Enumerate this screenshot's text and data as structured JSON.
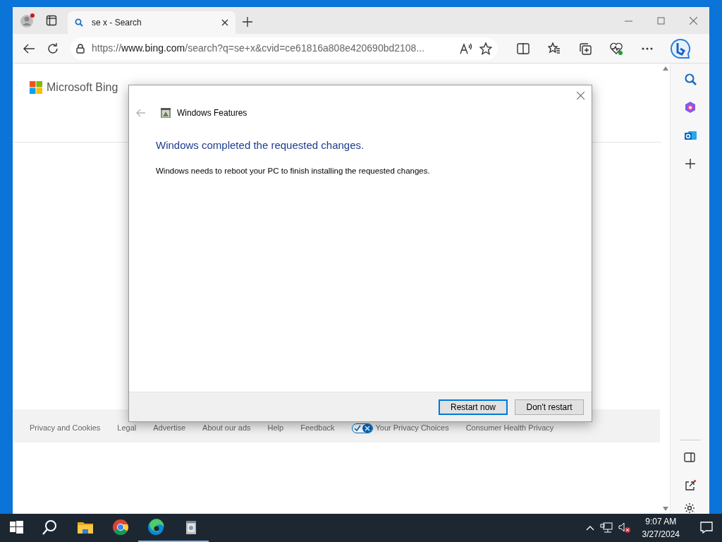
{
  "browser": {
    "tab": {
      "title": "se x - Search",
      "selected": true
    },
    "address": {
      "scheme": "https://",
      "host": "www.bing.com",
      "path": "/search?q=se+x&cvid=ce61816a808e420690bd2108..."
    }
  },
  "page": {
    "logo": "Microsoft Bing",
    "footer_links": [
      {
        "label": "Privacy and Cookies"
      },
      {
        "label": "Legal"
      },
      {
        "label": "Advertise"
      },
      {
        "label": "About our ads"
      },
      {
        "label": "Help"
      },
      {
        "label": "Feedback"
      },
      {
        "label": "Your Privacy Choices",
        "kind": "privacy"
      },
      {
        "label": "Consumer Health Privacy"
      }
    ]
  },
  "dialog": {
    "title": "Windows Features",
    "heading": "Windows completed the requested changes.",
    "message": "Windows needs to reboot your PC to finish installing the requested changes.",
    "buttons": [
      {
        "label": "Restart now",
        "selected": true
      },
      {
        "label": "Don't restart",
        "selected": false
      }
    ]
  },
  "taskbar": {
    "apps": [
      {
        "kind": "folder",
        "running": false
      },
      {
        "kind": "chrome",
        "running": false
      },
      {
        "kind": "edge",
        "running": true
      },
      {
        "kind": "features",
        "running": true
      }
    ],
    "time": "9:07 AM",
    "date": "3/27/2024"
  }
}
